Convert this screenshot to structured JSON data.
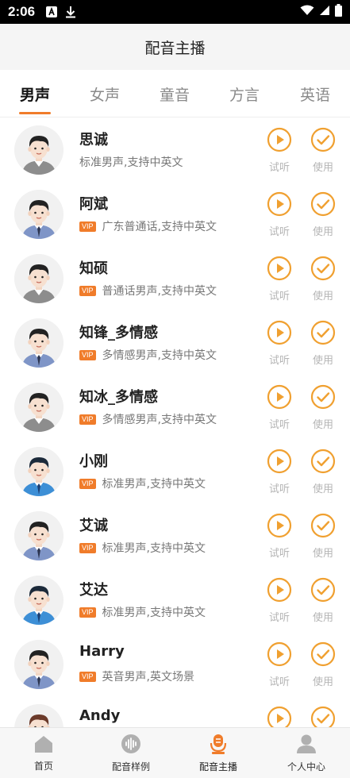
{
  "status": {
    "time": "2:06"
  },
  "appbar": {
    "title": "配音主播"
  },
  "tabs": [
    {
      "label": "男声",
      "active": true
    },
    {
      "label": "女声",
      "active": false
    },
    {
      "label": "童音",
      "active": false
    },
    {
      "label": "方言",
      "active": false
    },
    {
      "label": "英语",
      "active": false
    }
  ],
  "actions": {
    "play_label": "试听",
    "use_label": "使用"
  },
  "voices": [
    {
      "name": "思诚",
      "vip": false,
      "desc": "标准男声,支持中英文",
      "avatar": "male-avatar-grey"
    },
    {
      "name": "阿斌",
      "vip": true,
      "vip_label": "VIP",
      "desc": "广东普通话,支持中英文",
      "avatar": "male-avatar-suit"
    },
    {
      "name": "知硕",
      "vip": true,
      "vip_label": "VIP",
      "desc": "普通话男声,支持中英文",
      "avatar": "male-avatar-grey"
    },
    {
      "name": "知锋_多情感",
      "vip": true,
      "vip_label": "VIP",
      "desc": "多情感男声,支持中英文",
      "avatar": "male-avatar-suit"
    },
    {
      "name": "知冰_多情感",
      "vip": true,
      "vip_label": "VIP",
      "desc": "多情感男声,支持中英文",
      "avatar": "male-avatar-grey"
    },
    {
      "name": "小刚",
      "vip": true,
      "vip_label": "VIP",
      "desc": "标准男声,支持中英文",
      "avatar": "male-avatar-blue"
    },
    {
      "name": "艾诚",
      "vip": true,
      "vip_label": "VIP",
      "desc": "标准男声,支持中英文",
      "avatar": "male-avatar-suit"
    },
    {
      "name": "艾达",
      "vip": true,
      "vip_label": "VIP",
      "desc": "标准男声,支持中英文",
      "avatar": "male-avatar-blue"
    },
    {
      "name": "Harry",
      "vip": true,
      "vip_label": "VIP",
      "desc": "英音男声,英文场景",
      "avatar": "male-avatar-suit"
    },
    {
      "name": "Andy",
      "vip": false,
      "desc": "",
      "avatar": "male-avatar-brown"
    }
  ],
  "bottom_nav": [
    {
      "label": "首页",
      "icon": "home-icon",
      "active": false
    },
    {
      "label": "配音样例",
      "icon": "waveform-icon",
      "active": false
    },
    {
      "label": "配音主播",
      "icon": "anchor-icon",
      "active": true
    },
    {
      "label": "个人中心",
      "icon": "person-icon",
      "active": false
    }
  ],
  "colors": {
    "accent": "#f07c2a",
    "action": "#f0a030",
    "muted": "#b5b5b5"
  }
}
